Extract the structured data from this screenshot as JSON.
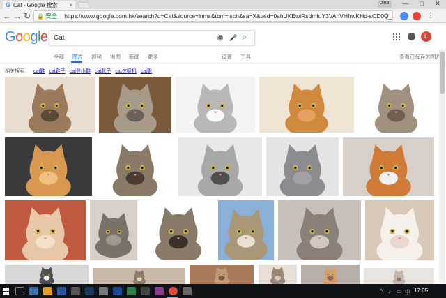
{
  "browser": {
    "tab_title": "Cat - Google 搜索",
    "tab_favicon": "G",
    "close_tab": "×",
    "profile_chip": "Jina",
    "window_min": "—",
    "window_max": "□",
    "window_close": "✕",
    "back": "←",
    "forward": "→",
    "reload": "↻",
    "secure_label": "安全",
    "url": "https://www.google.com.hk/search?q=Cat&source=lnms&tbm=isch&sa=X&ved=0ahUKEwiRsdmfuY3VAhVHfrwKHd-sCD0Q_AUICigB&biw",
    "star": "☆"
  },
  "google": {
    "logo_letters": [
      "G",
      "o",
      "o",
      "g",
      "l",
      "e"
    ],
    "query": "Cat",
    "camera_icon": "◉",
    "mic_icon": "🎤",
    "search_icon": "⌕",
    "avatar_letter": "L",
    "tabs": [
      {
        "label": "全部"
      },
      {
        "label": "图片"
      },
      {
        "label": "视频"
      },
      {
        "label": "地图"
      },
      {
        "label": "新闻"
      },
      {
        "label": "更多"
      }
    ],
    "settings_label": "设置",
    "tools_label": "工具",
    "saved_images_label": "查看已保存的图片",
    "related_prefix": "相关搜索：",
    "related": [
      "cat鞋",
      "cat鞋子",
      "cat登山鞋",
      "cat靴子",
      "cat挖掘机",
      "cat靴"
    ]
  },
  "taskbar": {
    "clock": "17:05",
    "tray_icons": [
      "^",
      "♪",
      "▭",
      "中"
    ]
  },
  "colors": {
    "accent": "#1a73e8",
    "link": "#1a0dab",
    "secure": "#0b8043",
    "avatar": "#db4437"
  }
}
